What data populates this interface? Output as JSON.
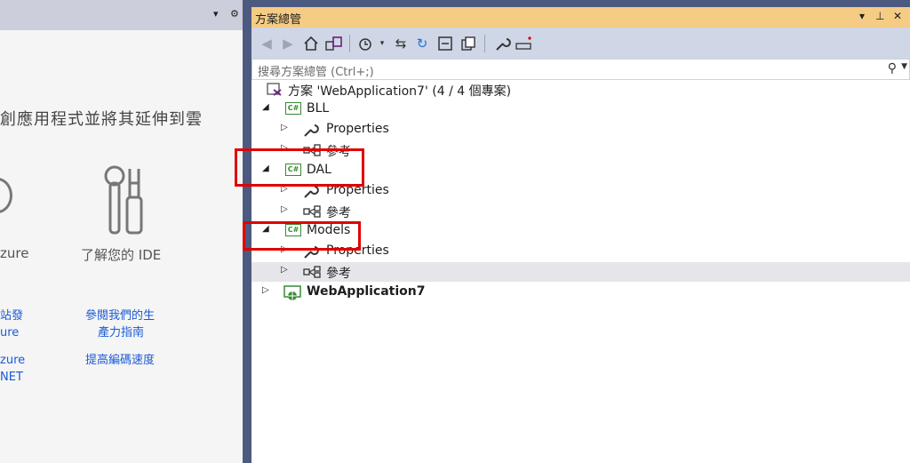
{
  "left": {
    "headline": "創應用程式並將其延伸到雲",
    "cap_azure": "zure",
    "cap_ide": "了解您的 IDE",
    "links": {
      "a1": "站發",
      "a2": "ure",
      "a3": "zure",
      "a4": "NET",
      "b1": "參閱我們的生",
      "b2": "產力指南",
      "b3": "提高編碼速度"
    },
    "header_controls": {
      "dropdown": "▾",
      "gear": "⚙"
    }
  },
  "solution_explorer": {
    "title": "方案總管",
    "title_controls": {
      "dropdown": "▾",
      "pin": "⊥",
      "close": "✕"
    },
    "search_placeholder": "搜尋方案總管 (Ctrl+;)",
    "tree": [
      {
        "label": "方案 'WebApplication7' (4 / 4 個專案)",
        "icon": "solution-icon",
        "arrow": "",
        "bold": false
      },
      {
        "label": "BLL",
        "icon": "csharp-project-icon",
        "arrow": "◢",
        "bold": false
      },
      {
        "label": "Properties",
        "icon": "wrench-icon",
        "arrow": "▷",
        "bold": false
      },
      {
        "label": "參考",
        "icon": "references-icon",
        "arrow": "▷",
        "bold": false
      },
      {
        "label": "DAL",
        "icon": "csharp-project-icon",
        "arrow": "◢",
        "bold": false
      },
      {
        "label": "Properties",
        "icon": "wrench-icon",
        "arrow": "▷",
        "bold": false
      },
      {
        "label": "參考",
        "icon": "references-icon",
        "arrow": "▷",
        "bold": false
      },
      {
        "label": "Models",
        "icon": "csharp-project-icon",
        "arrow": "◢",
        "bold": false
      },
      {
        "label": "Properties",
        "icon": "wrench-icon",
        "arrow": "▷",
        "bold": false
      },
      {
        "label": "參考",
        "icon": "references-icon",
        "arrow": "▷",
        "bold": false
      },
      {
        "label": "WebApplication7",
        "icon": "web-project-icon",
        "arrow": "▷",
        "bold": true
      }
    ],
    "highlighted_row": 9
  },
  "colors": {
    "title_bar": "#f5cc84",
    "toolbar": "#cfd6e5",
    "frame": "#4d5a80",
    "callout": "#e00000",
    "csharp_green": "#388a34"
  }
}
